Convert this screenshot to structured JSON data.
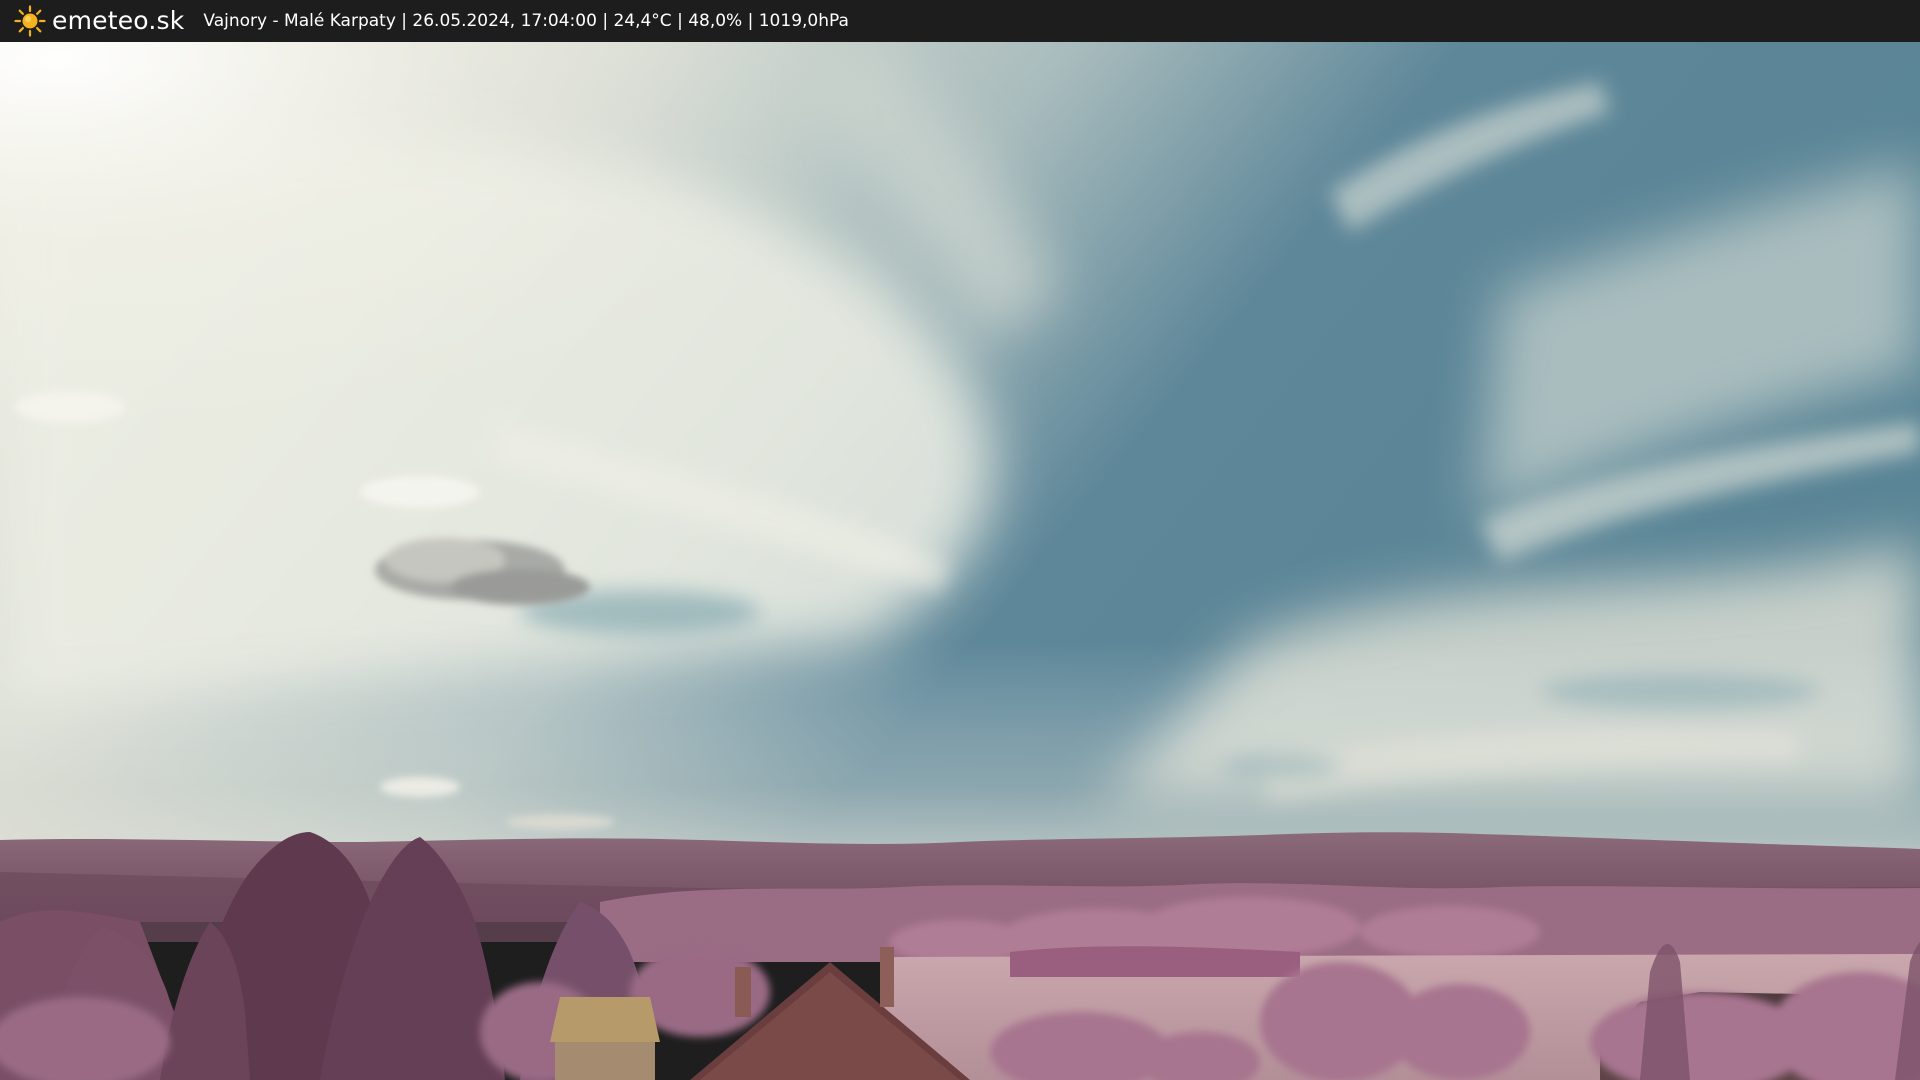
{
  "header": {
    "logo_icon": "sun-icon",
    "brand": "emeteo.sk",
    "caption": "Vajnory - Malé Karpaty | 26.05.2024, 17:04:00 | 24,4°C | 48,0% | 1019,0hPa"
  },
  "colors": {
    "bar": "#1d1d1d",
    "sun": "#f5b21f",
    "sky_blue": "#4f7f92",
    "cloud_white": "#e8e8de",
    "hills": "#7d5a6c",
    "foliage": "#8a5c74"
  }
}
